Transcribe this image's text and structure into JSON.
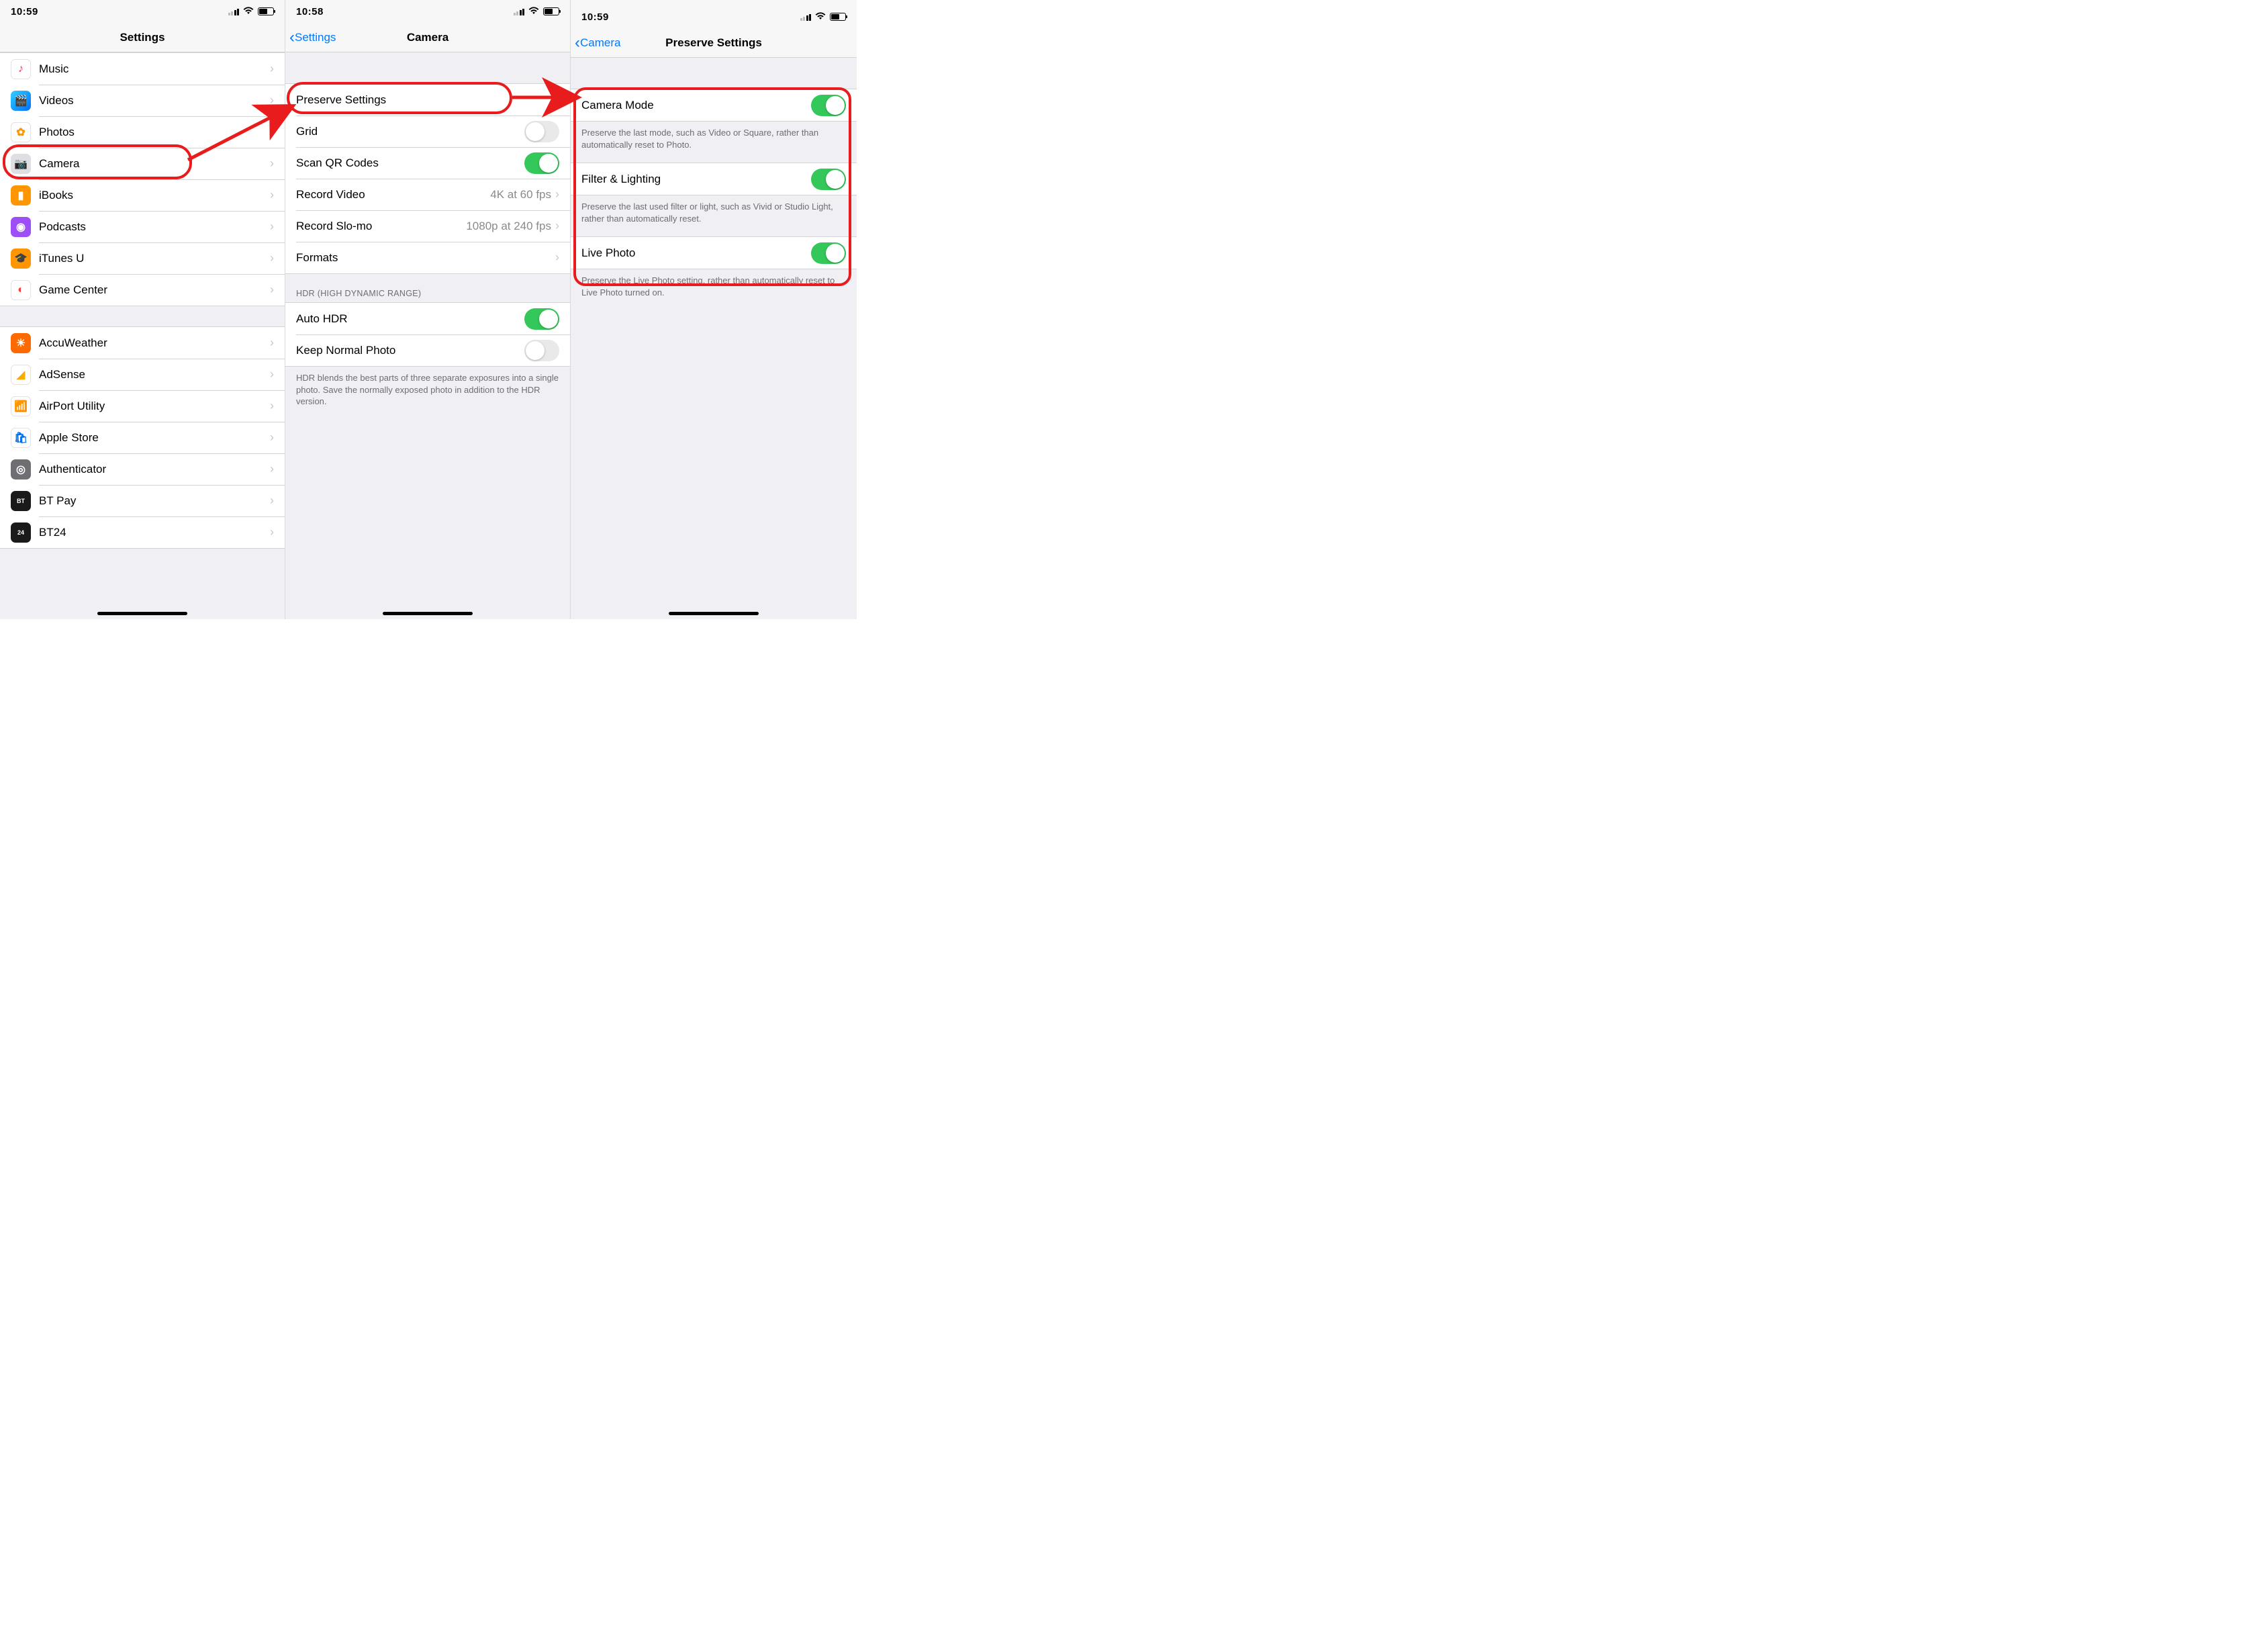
{
  "panes": {
    "settings": {
      "status_time": "10:59",
      "nav_title": "Settings",
      "rows": [
        {
          "label": "Music",
          "icon_bg": "#fff",
          "icon": "♪",
          "icon_color": "#ff2d55"
        },
        {
          "label": "Videos",
          "icon_bg": "linear-gradient(135deg,#32d0ff,#006eff)",
          "icon": "🎬"
        },
        {
          "label": "Photos",
          "icon_bg": "#fff",
          "icon": "✿",
          "icon_color": "#ff9500"
        },
        {
          "label": "Camera",
          "icon_bg": "#dfdfe3",
          "icon": "📷",
          "highlight": true
        },
        {
          "label": "iBooks",
          "icon_bg": "#ff9500",
          "icon": "▮"
        },
        {
          "label": "Podcasts",
          "icon_bg": "#9d4ef7",
          "icon": "◉"
        },
        {
          "label": "iTunes U",
          "icon_bg": "#ff9500",
          "icon": "🎓"
        },
        {
          "label": "Game Center",
          "icon_bg": "#fff",
          "icon": "◐",
          "icon_color": "#ff3b30"
        }
      ],
      "third_party_rows": [
        {
          "label": "AccuWeather",
          "icon_bg": "#ff6a00",
          "icon": "☀"
        },
        {
          "label": "AdSense",
          "icon_bg": "#fff",
          "icon": "◢",
          "icon_color": "#f9ab00"
        },
        {
          "label": "AirPort Utility",
          "icon_bg": "#fff",
          "icon": "📶",
          "icon_color": "#007aff"
        },
        {
          "label": "Apple Store",
          "icon_bg": "#fff",
          "icon": "🛍",
          "icon_color": "#0071e3"
        },
        {
          "label": "Authenticator",
          "icon_bg": "#6e6e73",
          "icon": "◎"
        },
        {
          "label": "BT Pay",
          "icon_bg": "#1a1a1a",
          "icon": "BT",
          "icon_font": "9px"
        },
        {
          "label": "BT24",
          "icon_bg": "#1a1a1a",
          "icon": "24",
          "icon_font": "9px"
        }
      ]
    },
    "camera": {
      "status_time": "10:58",
      "back_label": "Settings",
      "nav_title": "Camera",
      "group1": [
        {
          "label": "Preserve Settings",
          "type": "disclosure",
          "highlight": true
        },
        {
          "label": "Grid",
          "type": "switch",
          "on": false
        },
        {
          "label": "Scan QR Codes",
          "type": "switch",
          "on": true
        },
        {
          "label": "Record Video",
          "type": "value",
          "value": "4K at 60 fps"
        },
        {
          "label": "Record Slo-mo",
          "type": "value",
          "value": "1080p at 240 fps"
        },
        {
          "label": "Formats",
          "type": "disclosure"
        }
      ],
      "hdr_header": "HDR (HIGH DYNAMIC RANGE)",
      "group2": [
        {
          "label": "Auto HDR",
          "type": "switch",
          "on": true
        },
        {
          "label": "Keep Normal Photo",
          "type": "switch",
          "on": false
        }
      ],
      "hdr_footer": "HDR blends the best parts of three separate exposures into a single photo. Save the normally exposed photo in addition to the HDR version."
    },
    "preserve": {
      "status_time": "10:59",
      "back_label": "Camera",
      "nav_title": "Preserve Settings",
      "items": {
        "camera_mode": {
          "label": "Camera Mode",
          "on": true,
          "footer": "Preserve the last mode, such as Video or Square, rather than automatically reset to Photo."
        },
        "filter_lighting": {
          "label": "Filter & Lighting",
          "on": true,
          "footer": "Preserve the last used filter or light, such as Vivid or Studio Light, rather than automatically reset."
        },
        "live_photo": {
          "label": "Live Photo",
          "on": true,
          "footer": "Preserve the Live Photo setting, rather than automatically reset to Live Photo turned on."
        }
      }
    }
  }
}
